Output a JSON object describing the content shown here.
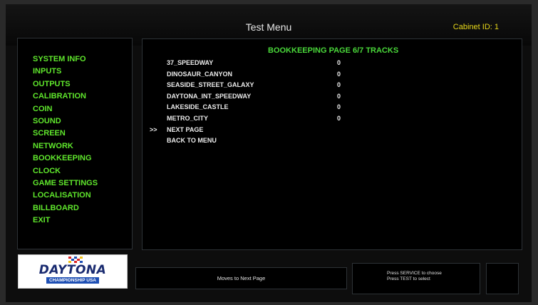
{
  "header": {
    "title": "Test Menu",
    "cabinet_id": "Cabinet ID: 1"
  },
  "sidebar": {
    "items": [
      {
        "label": "SYSTEM INFO"
      },
      {
        "label": "INPUTS"
      },
      {
        "label": "OUTPUTS"
      },
      {
        "label": "CALIBRATION"
      },
      {
        "label": "COIN"
      },
      {
        "label": "SOUND"
      },
      {
        "label": "SCREEN"
      },
      {
        "label": "NETWORK"
      },
      {
        "label": "BOOKKEEPING"
      },
      {
        "label": "CLOCK"
      },
      {
        "label": "GAME SETTINGS"
      },
      {
        "label": "LOCALISATION"
      },
      {
        "label": "BILLBOARD"
      },
      {
        "label": "EXIT"
      }
    ]
  },
  "main": {
    "heading": "BOOKKEEPING PAGE 6/7  TRACKS",
    "rows": [
      {
        "label": "37_SPEEDWAY",
        "value": "0",
        "cursor": ""
      },
      {
        "label": "DINOSAUR_CANYON",
        "value": "0",
        "cursor": ""
      },
      {
        "label": "SEASIDE_STREET_GALAXY",
        "value": "0",
        "cursor": ""
      },
      {
        "label": "DAYTONA_INT_SPEEDWAY",
        "value": "0",
        "cursor": ""
      },
      {
        "label": "LAKESIDE_CASTLE",
        "value": "0",
        "cursor": ""
      },
      {
        "label": "METRO_CITY",
        "value": "0",
        "cursor": ""
      },
      {
        "label": "NEXT PAGE",
        "value": "",
        "cursor": ">>"
      },
      {
        "label": "BACK TO MENU",
        "value": "",
        "cursor": ""
      }
    ]
  },
  "footer": {
    "logo_title": "DAYTONA",
    "logo_subtitle": "CHAMPIONSHIP USA",
    "help_text": "Moves to Next Page",
    "instruction_line1": "Press SERVICE to choose",
    "instruction_line2": "Press TEST to select"
  },
  "colors": {
    "menu_green": "#5fe62c",
    "heading_green": "#4ad83a",
    "cabinet_yellow": "#e8d81a",
    "logo_blue": "#1a2b70"
  }
}
